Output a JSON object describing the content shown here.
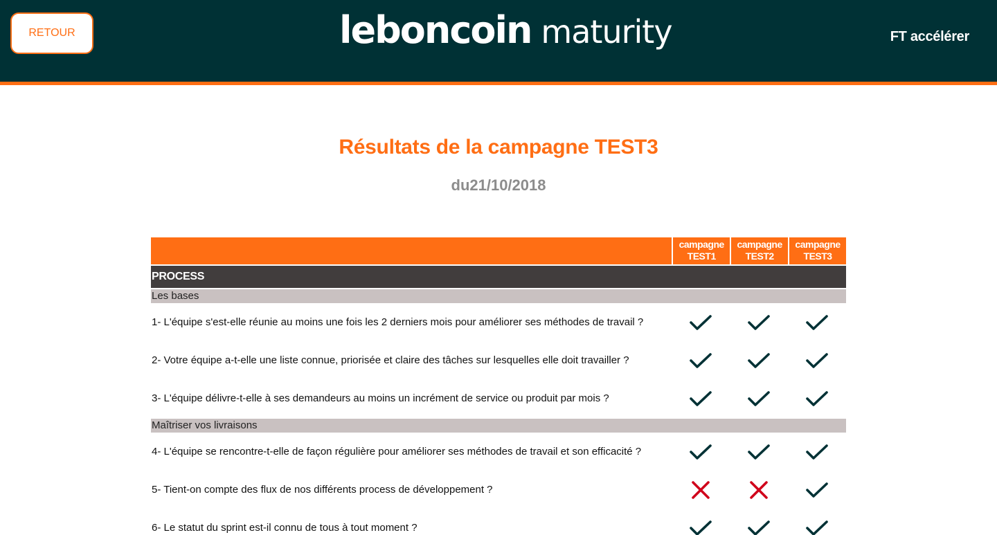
{
  "header": {
    "back_label": "RETOUR",
    "logo_brand": "leboncoin",
    "logo_suffix": "maturity",
    "team_name": "FT accélérer"
  },
  "page": {
    "title": "Résultats de la campagne TEST3",
    "subtitle": "du21/10/2018"
  },
  "colors": {
    "header_bg": "#003135",
    "accent": "#ff6e14",
    "section_bg": "#413d3d",
    "subsection_bg": "#c9c1c1",
    "check": "#003135",
    "cross": "#d0021b"
  },
  "table": {
    "columns": [
      "campagne TEST1",
      "campagne TEST2",
      "campagne TEST3"
    ],
    "section": "PROCESS",
    "groups": [
      {
        "label": "Les bases",
        "questions": [
          {
            "text": "1- L'équipe s'est-elle réunie au moins une fois les 2 derniers mois pour améliorer ses méthodes de travail ?",
            "results": [
              "check-icon",
              "check-icon",
              "check-icon"
            ]
          },
          {
            "text": "2- Votre équipe a-t-elle une liste connue, priorisée et claire des tâches sur lesquelles elle doit travailler ?",
            "results": [
              "check-icon",
              "check-icon",
              "check-icon"
            ]
          },
          {
            "text": "3- L'équipe délivre-t-elle à ses demandeurs au moins un incrément de service ou produit par mois ?",
            "results": [
              "check-icon",
              "check-icon",
              "check-icon"
            ]
          }
        ]
      },
      {
        "label": "Maîtriser vos livraisons",
        "questions": [
          {
            "text": "4- L'équipe se rencontre-t-elle de façon régulière pour améliorer ses méthodes de travail et son efficacité ?",
            "results": [
              "check-icon",
              "check-icon",
              "check-icon"
            ]
          },
          {
            "text": "5- Tient-on compte des flux de nos différents process de développement ?",
            "results": [
              "cross-icon",
              "cross-icon",
              "check-icon"
            ]
          },
          {
            "text": "6- Le statut du sprint est-il connu de tous à tout moment ?",
            "results": [
              "check-icon",
              "check-icon",
              "check-icon"
            ]
          }
        ]
      }
    ]
  }
}
